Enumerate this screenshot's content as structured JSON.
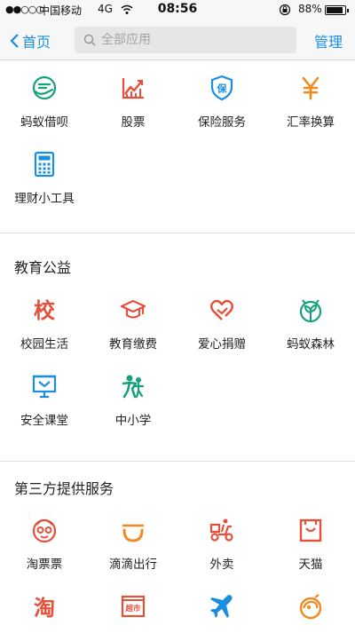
{
  "status": {
    "signal": "●●○○○",
    "carrier": "中国移动",
    "network": "4G",
    "time": "08:56",
    "battery_text": "88%",
    "battery_level": 0.88
  },
  "nav": {
    "back_label": "首页",
    "search_placeholder": "全部应用",
    "manage_label": "管理"
  },
  "colors": {
    "accent": "#1a8ee0",
    "red": "#e5503b",
    "green": "#17a07f",
    "orange": "#f08a20",
    "blue": "#1a8ee0"
  },
  "finance": {
    "items": [
      {
        "label": "蚂蚁借呗",
        "icon": "ant-credit-icon"
      },
      {
        "label": "股票",
        "icon": "stock-chart-icon"
      },
      {
        "label": "保险服务",
        "icon": "insurance-shield-icon"
      },
      {
        "label": "汇率换算",
        "icon": "yen-currency-icon"
      },
      {
        "label": "理财小工具",
        "icon": "calculator-icon"
      }
    ]
  },
  "education": {
    "title": "教育公益",
    "items": [
      {
        "label": "校园生活",
        "icon": "school-char-icon"
      },
      {
        "label": "教育缴费",
        "icon": "graduation-cap-icon"
      },
      {
        "label": "爱心捐赠",
        "icon": "heart-donation-icon"
      },
      {
        "label": "蚂蚁森林",
        "icon": "sprout-icon"
      },
      {
        "label": "安全课堂",
        "icon": "safety-board-icon"
      },
      {
        "label": "中小学",
        "icon": "students-icon"
      }
    ]
  },
  "third_party": {
    "title": "第三方提供服务",
    "items": [
      {
        "label": "淘票票",
        "icon": "movie-ticket-face-icon"
      },
      {
        "label": "滴滴出行",
        "icon": "didi-icon"
      },
      {
        "label": "外卖",
        "icon": "delivery-scooter-icon"
      },
      {
        "label": "天猫",
        "icon": "tmall-bag-icon"
      },
      {
        "label": "",
        "icon": "taobao-icon",
        "glyph": "淘"
      },
      {
        "label": "",
        "icon": "supermarket-icon",
        "glyph": "超市"
      },
      {
        "label": "",
        "icon": "airplane-icon"
      },
      {
        "label": "",
        "icon": "food-icon"
      }
    ]
  }
}
